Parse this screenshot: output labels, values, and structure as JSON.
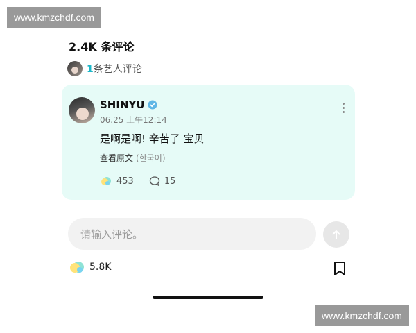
{
  "watermark": {
    "text": "www.kmzchdf.com"
  },
  "header": {
    "title": "2.4K 条评论"
  },
  "artist_comments": {
    "count": "1",
    "label": "条艺人评论"
  },
  "comment": {
    "username": "SHINYU",
    "timestamp": "06.25 上午12:14",
    "text": "是啊是啊! 辛苦了 宝贝",
    "translate_label": "查看原文",
    "original_lang": "(한국어)",
    "likes": "453",
    "replies": "15"
  },
  "composer": {
    "placeholder": "请输入评论。"
  },
  "footer": {
    "likes": "5.8K"
  },
  "colors": {
    "accent": "#1db7c9",
    "card_bg": "#e6fbf7",
    "verified": "#5fb6e5"
  },
  "icons": [
    "verified-icon",
    "more-icon",
    "like-icon",
    "reply-icon",
    "send-icon",
    "bookmark-icon"
  ]
}
